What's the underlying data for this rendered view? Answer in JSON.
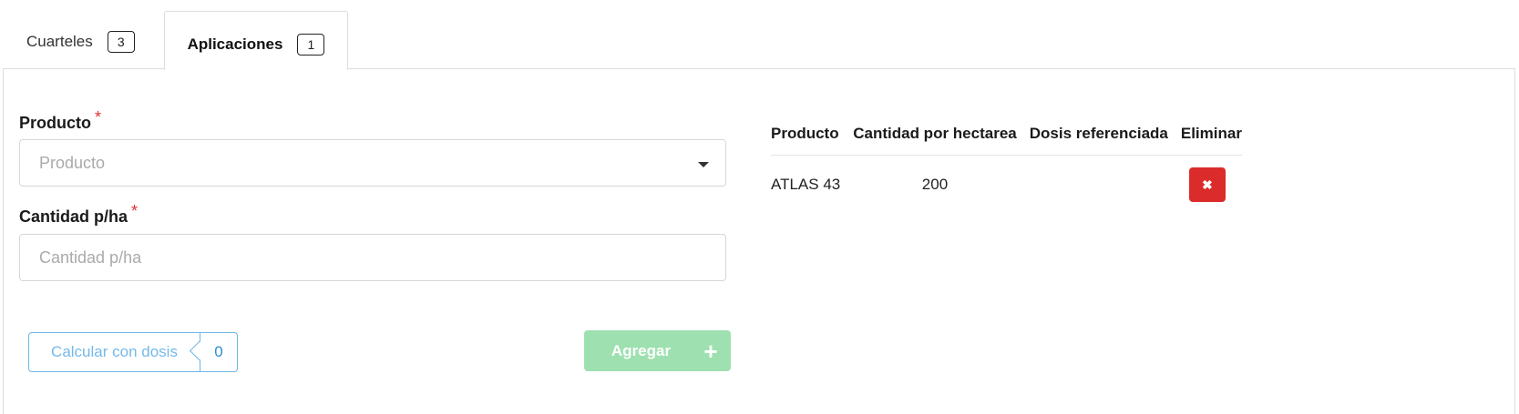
{
  "tabs": [
    {
      "label": "Cuarteles",
      "count": "3"
    },
    {
      "label": "Aplicaciones",
      "count": "1"
    }
  ],
  "form": {
    "producto": {
      "label": "Producto",
      "required": "*",
      "placeholder": "Producto"
    },
    "cantidad": {
      "label": "Cantidad p/ha",
      "required": "*",
      "placeholder": "Cantidad p/ha"
    },
    "calc_button": {
      "label": "Calcular con dosis",
      "count": "0"
    },
    "add_button": {
      "label": "Agregar",
      "icon": "plus-icon"
    }
  },
  "table": {
    "headers": [
      "Producto",
      "Cantidad por hectarea",
      "Dosis referenciada",
      "Eliminar"
    ],
    "rows": [
      {
        "producto": "ATLAS 43",
        "cantidad": "200",
        "dosis": "",
        "delete_icon": "✖"
      }
    ]
  },
  "colors": {
    "required": "#e03030",
    "calc_accent": "#6cb7e6",
    "add_button": "#9ee0b0",
    "delete_button": "#dc2b2b"
  }
}
